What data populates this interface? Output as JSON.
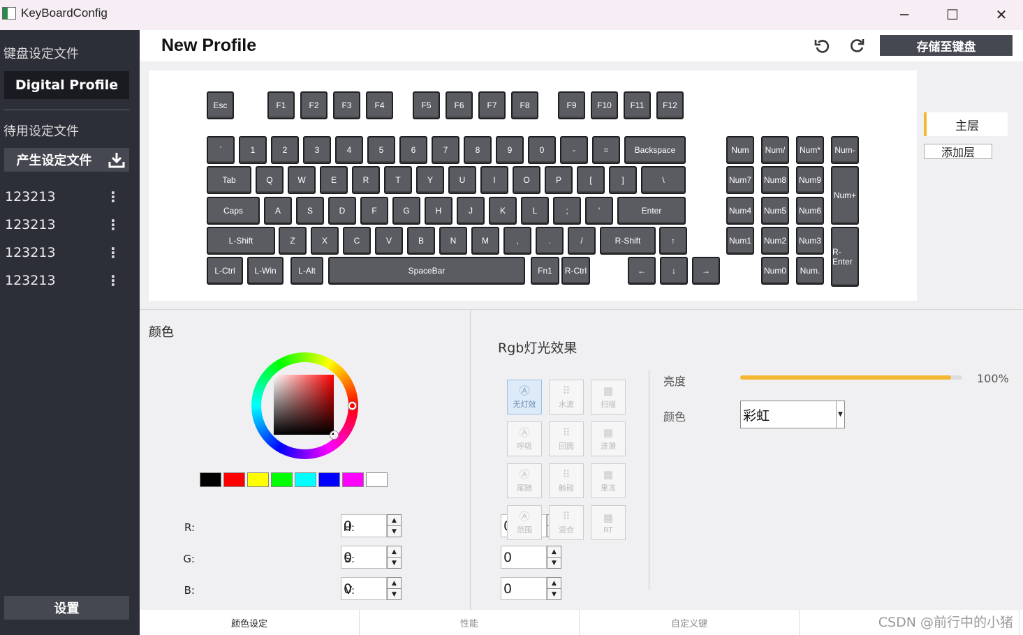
{
  "window": {
    "title": "KeyBoardConfig",
    "controls": [
      "─",
      "☐",
      "✕"
    ]
  },
  "sidebar": {
    "profiles_label": "键盘设定文件",
    "current_profile": "Digital Profile",
    "standby_label": "待用设定文件",
    "generate_label": "产生设定文件",
    "generate_icon": "download-icon",
    "items": [
      {
        "label": "123213",
        "menu": "⋮"
      },
      {
        "label": "123213",
        "menu": "⋮"
      },
      {
        "label": "123213",
        "menu": "⋮"
      },
      {
        "label": "123213",
        "menu": "⋮"
      }
    ],
    "settings_label": "设置"
  },
  "header": {
    "title": "New Profile",
    "icons": [
      "undo-icon",
      "refresh-icon"
    ],
    "save_label": "存储至键盘"
  },
  "keyboard": {
    "keys": [
      "Esc",
      "F1",
      "F2",
      "F3",
      "F4",
      "F5",
      "F6",
      "F7",
      "F8",
      "F9",
      "F10",
      "F11",
      "F12",
      "`",
      "1",
      "2",
      "3",
      "4",
      "5",
      "6",
      "7",
      "8",
      "9",
      "0",
      "-",
      "=",
      "Backspace",
      "Tab",
      "Q",
      "W",
      "E",
      "R",
      "T",
      "Y",
      "U",
      "I",
      "O",
      "P",
      "[",
      "]",
      "\\",
      "Caps",
      "A",
      "S",
      "D",
      "F",
      "G",
      "H",
      "J",
      "K",
      "L",
      ";",
      "'",
      "Enter",
      "L-Shift",
      "Z",
      "X",
      "C",
      "V",
      "B",
      "N",
      "M",
      ",",
      ".",
      "/",
      "R-Shift",
      "↑",
      "L-Ctrl",
      "L-Win",
      "L-Alt",
      "SpaceBar",
      "Fn1",
      "R-Ctrl",
      "←",
      "↓",
      "→",
      "Num",
      "Num/",
      "Num*",
      "Num-",
      "Num7",
      "Num8",
      "Num9",
      "Num+",
      "Num4",
      "Num5",
      "Num6",
      "Num1",
      "Num2",
      "Num3",
      "R-Enter",
      "Num0",
      "Num."
    ]
  },
  "layers": {
    "main": "主层",
    "add": "添加层",
    "accent": "#f5b731"
  },
  "color_panel": {
    "title": "颜色",
    "swatches": [
      "#000000",
      "#ff0000",
      "#ffff00",
      "#00ff00",
      "#00ffff",
      "#0000ff",
      "#ff00ff",
      "#ffffff"
    ],
    "fields": [
      {
        "label": "R:",
        "value": "0"
      },
      {
        "label": "G:",
        "value": "0"
      },
      {
        "label": "B:",
        "value": "0"
      },
      {
        "label": "H:",
        "value": "0"
      },
      {
        "label": "S:",
        "value": "0"
      },
      {
        "label": "V:",
        "value": "0"
      }
    ]
  },
  "rgb": {
    "title": "Rgb灯光效果",
    "effects": [
      {
        "label": "无灯效",
        "icon": "letter-a-icon"
      },
      {
        "label": "水波",
        "icon": "dots-grid-icon"
      },
      {
        "label": "扫描",
        "icon": "keyboard-icon"
      },
      {
        "label": "呼吸",
        "icon": "letter-a-icon"
      },
      {
        "label": "回圆",
        "icon": "dots-grid-icon"
      },
      {
        "label": "涟漪",
        "icon": "keyboard-icon"
      },
      {
        "label": "尾随",
        "icon": "letter-a-icon"
      },
      {
        "label": "触碰",
        "icon": "dots-grid-icon"
      },
      {
        "label": "果冻",
        "icon": "keyboard-icon"
      },
      {
        "label": "范围",
        "icon": "letter-a-icon"
      },
      {
        "label": "混合",
        "icon": "dots-grid-icon"
      },
      {
        "label": "RT",
        "icon": "keyboard-icon"
      }
    ],
    "active_effect": "无灯效",
    "brightness_label": "亮度",
    "brightness_value": "100%",
    "brightness_fraction": 0.95,
    "color_label": "颜色",
    "color_value": "彩虹"
  },
  "tabs": [
    "颜色设定",
    "性能",
    "自定义键",
    ""
  ],
  "watermark": "CSDN @前行中的小猪"
}
